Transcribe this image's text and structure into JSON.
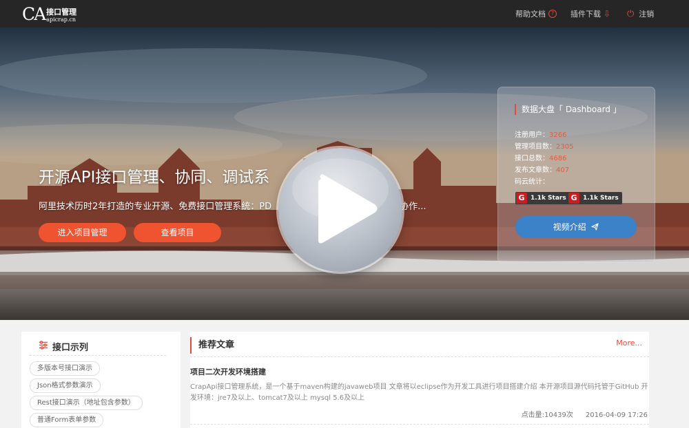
{
  "navbar": {
    "logo_mark": "CA",
    "logo_cn": "接口管理",
    "logo_en": "apicrap.cn",
    "help_label": "帮助文档",
    "help_icon": "question-circle-icon",
    "plugin_label": "插件下载",
    "plugin_icon": "arrow-down-icon",
    "logout_label": "注销",
    "logout_icon": "power-icon"
  },
  "hero": {
    "title": "开源API接口管理、协同、调试系",
    "subtitle": "阿里技术历时2年打造的专业开源、免费接口管理系统：PD",
    "subtitle_tail": "协作...",
    "enter_button": "进入项目管理",
    "view_button": "查看项目"
  },
  "dashboard": {
    "title": "数据大盘「 Dashboard 」",
    "stats": [
      {
        "label": "注册用户：",
        "value": "3266"
      },
      {
        "label": "管理项目数：",
        "value": "2305"
      },
      {
        "label": "接口总数：",
        "value": "4686"
      },
      {
        "label": "发布文章数：",
        "value": "407"
      },
      {
        "label": "码云统计：",
        "value": ""
      }
    ],
    "badges": [
      {
        "icon": "G",
        "text": "1.1k Stars"
      },
      {
        "icon": "G",
        "text": "1.1k Stars"
      }
    ],
    "video_button": "视频介绍",
    "video_icon": "paper-plane-icon"
  },
  "video_overlay": {
    "icon": "play-icon"
  },
  "examples": {
    "title": "接口示列",
    "icon": "sliders-icon",
    "items": [
      "多版本号接口演示",
      "Json格式参数演示",
      "Rest接口演示（地址包含参数）",
      "普通Form表单参数"
    ]
  },
  "recommended": {
    "title": "推荐文章",
    "more": "More...",
    "articles": [
      {
        "title": "项目二次开发环境搭建",
        "desc": "CrapApi接口管理系统，是一个基于maven构建的javaweb项目 文章将以eclipse作为开发工具进行项目搭建介绍 本开源项目源代码托管于GitHub 开发环境：jre7及以上、tomcat7及以上 mysql 5.6及以上",
        "clicks": "点击量:10439次",
        "date": "2016-04-09 17:26"
      }
    ]
  },
  "colors": {
    "accent": "#e5493a",
    "button": "#f0532f",
    "video_button": "#3c82c8",
    "navbar": "#262626"
  }
}
